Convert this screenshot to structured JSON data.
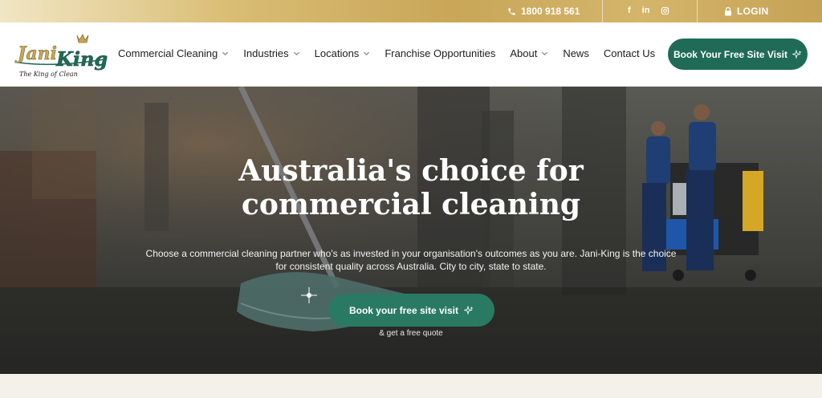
{
  "topbar": {
    "phone": "1800 918 561",
    "socials": [
      "f",
      "in",
      "instagram"
    ],
    "login": "LOGIN"
  },
  "logo": {
    "brand": "Jani King",
    "tagline": "The King of Clean"
  },
  "nav": {
    "items": [
      {
        "label": "Commercial Cleaning",
        "dropdown": true
      },
      {
        "label": "Industries",
        "dropdown": true
      },
      {
        "label": "Locations",
        "dropdown": true
      },
      {
        "label": "Franchise Opportunities",
        "dropdown": false
      },
      {
        "label": "About",
        "dropdown": true
      },
      {
        "label": "News",
        "dropdown": false
      },
      {
        "label": "Contact Us",
        "dropdown": false
      }
    ],
    "cta": "Book Your Free Site Visit"
  },
  "hero": {
    "title_line1": "Australia's choice for",
    "title_line2": "commercial cleaning",
    "subtitle_line1": "Choose a commercial cleaning partner who's as invested in your organisation's outcomes as you are. Jani-King is the choice",
    "subtitle_line2": "for consistent quality across Australia. City to city, state to state.",
    "cta": "Book your free site visit",
    "note": "& get a free quote"
  },
  "colors": {
    "brand_green": "#1f6b57",
    "gold": "#c9a658"
  }
}
